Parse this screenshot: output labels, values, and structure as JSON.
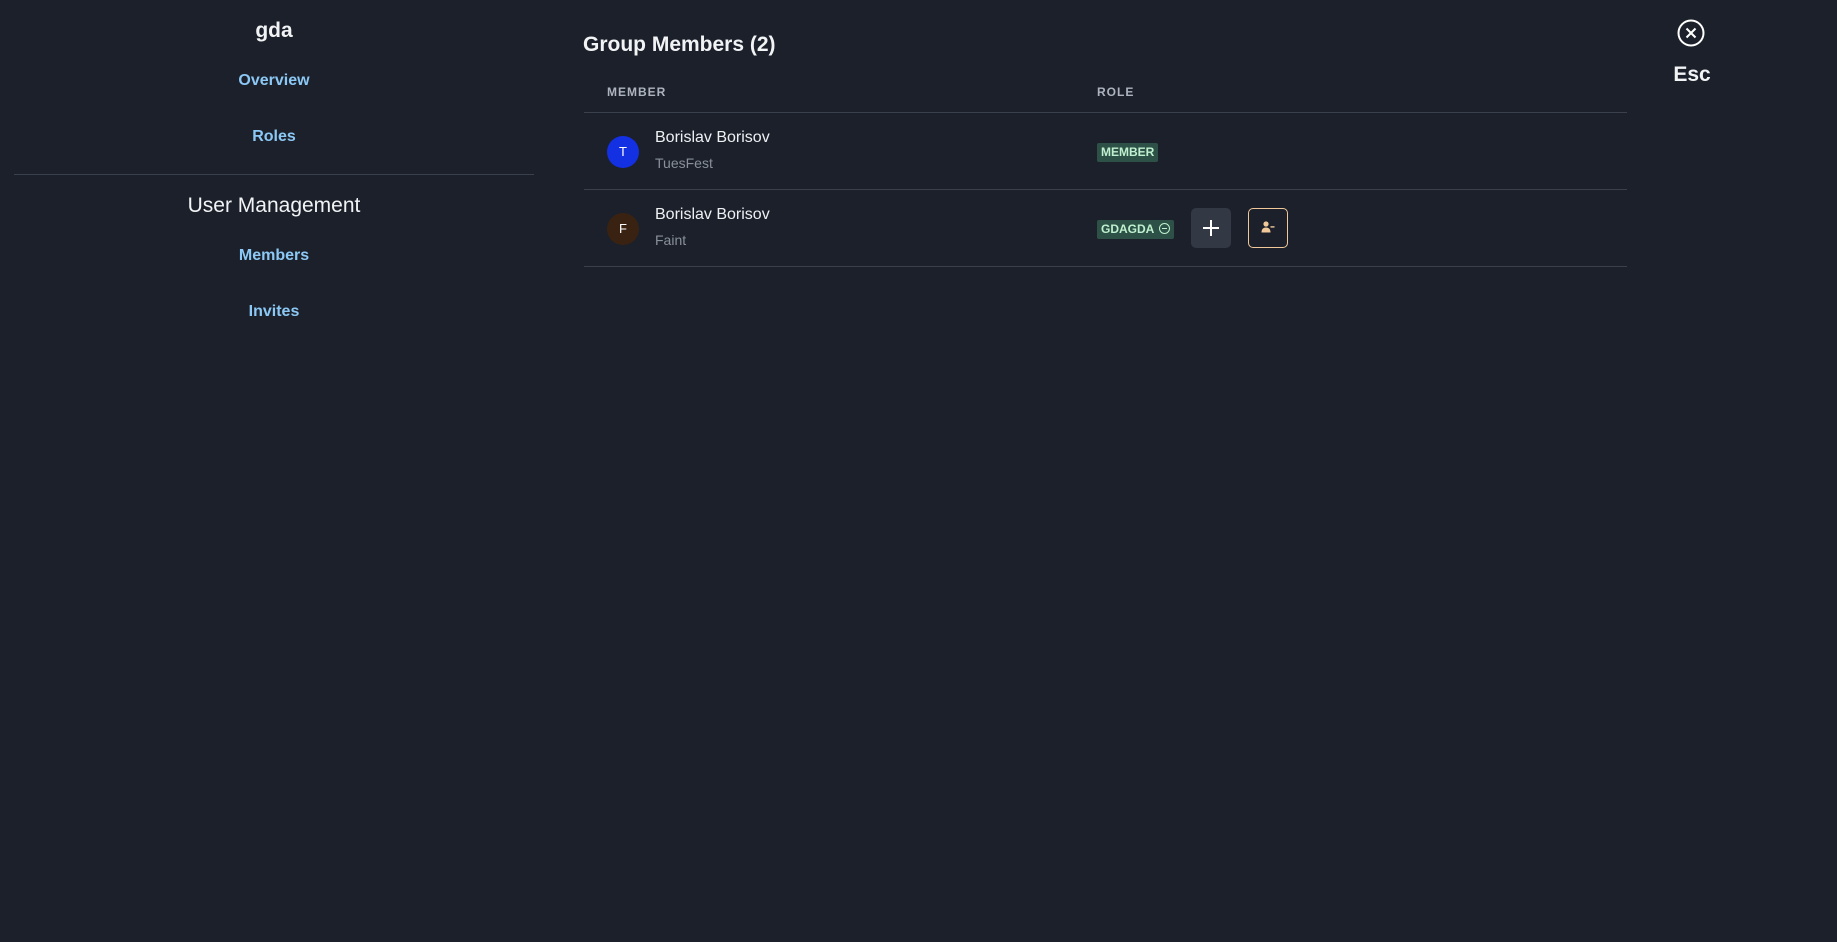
{
  "sidebar": {
    "server_name": "gda",
    "links": [
      {
        "label": "Overview"
      },
      {
        "label": "Roles"
      }
    ],
    "section_title": "User Management",
    "section_links": [
      {
        "label": "Members"
      },
      {
        "label": "Invites"
      }
    ]
  },
  "main": {
    "title": "Group Members (2)",
    "columns": {
      "member": "MEMBER",
      "role": "ROLE"
    },
    "rows": [
      {
        "avatar_letter": "T",
        "avatar_color": "#1430e3",
        "name": "Borislav Borisov",
        "subtitle": "TuesFest",
        "role": "MEMBER",
        "removable_role": false,
        "actions": false
      },
      {
        "avatar_letter": "F",
        "avatar_color": "#3a2212",
        "name": "Borislav Borisov",
        "subtitle": "Faint",
        "role": "GDAGDA",
        "removable_role": true,
        "actions": true,
        "icons": {
          "remove_role": "minus-circle-icon",
          "add_role": "plus-icon",
          "kick": "user-minus-icon"
        }
      }
    ]
  },
  "close": {
    "label": "Esc",
    "icon": "close-circle-icon"
  },
  "colors": {
    "background": "#1b202a",
    "link": "#8cc8f5",
    "role_badge_bg": "#2d5146",
    "role_badge_text": "#bff0cf",
    "kick_border": "#f0c89a"
  }
}
